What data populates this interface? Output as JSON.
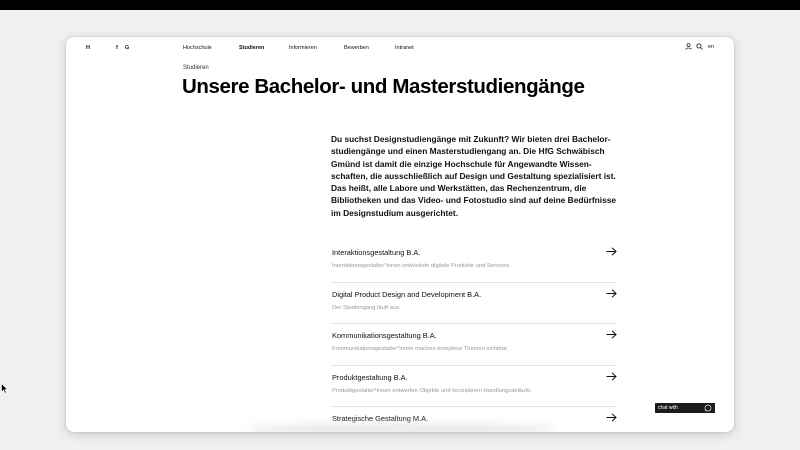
{
  "nav": {
    "logo": "H",
    "social_f": "f",
    "social_g": "G",
    "items": [
      {
        "label": "Hochschule"
      },
      {
        "label": "Studieren"
      },
      {
        "label": "Informieren"
      },
      {
        "label": "Bewerben"
      },
      {
        "label": "Intranet"
      }
    ],
    "language": "en",
    "icons": [
      "user-icon",
      "search-icon"
    ]
  },
  "breadcrumb": "Studieren",
  "title": "Unsere Bachelor- und Masterstudiengänge",
  "intro": "Du suchst Designstudiengänge mit Zukunft? Wir bieten drei Bachelor­studiengänge und einen Masterstudiengang an. Die HfG Schwäbisch Gmünd ist damit die einzige Hochschule für Angewandte Wissen­schaften, die ausschließlich auf Design und Gestaltung spezialisiert ist. Das heißt, alle Labore und Werkstätten, das Rechenzentrum, die Bibliotheken und das Video- und Fotostudio sind auf deine Bedürfnisse im Designstudium ausgerichtet.",
  "programs": [
    {
      "name": "Interaktionsgestaltung B.A.",
      "desc": "Interaktionsgestalter*innen entwickeln digitale Produkte und Services."
    },
    {
      "name": "Digital Product Design and Development B.A.",
      "desc": "Der Studiengang läuft aus."
    },
    {
      "name": "Kommunikationsgestaltung B.A.",
      "desc": "Kommunikationsgestalter*innen machen komplexe Themen sichtbar."
    },
    {
      "name": "Produktgestaltung B.A.",
      "desc": "Produktgestalter*innen entwerfen Objekte und konzipieren Handlungsabläufe."
    },
    {
      "name": "Strategische Gestaltung M.A.",
      "desc": ""
    }
  ],
  "chat": {
    "label": "chat with",
    "icon": "whatsapp-icon"
  }
}
